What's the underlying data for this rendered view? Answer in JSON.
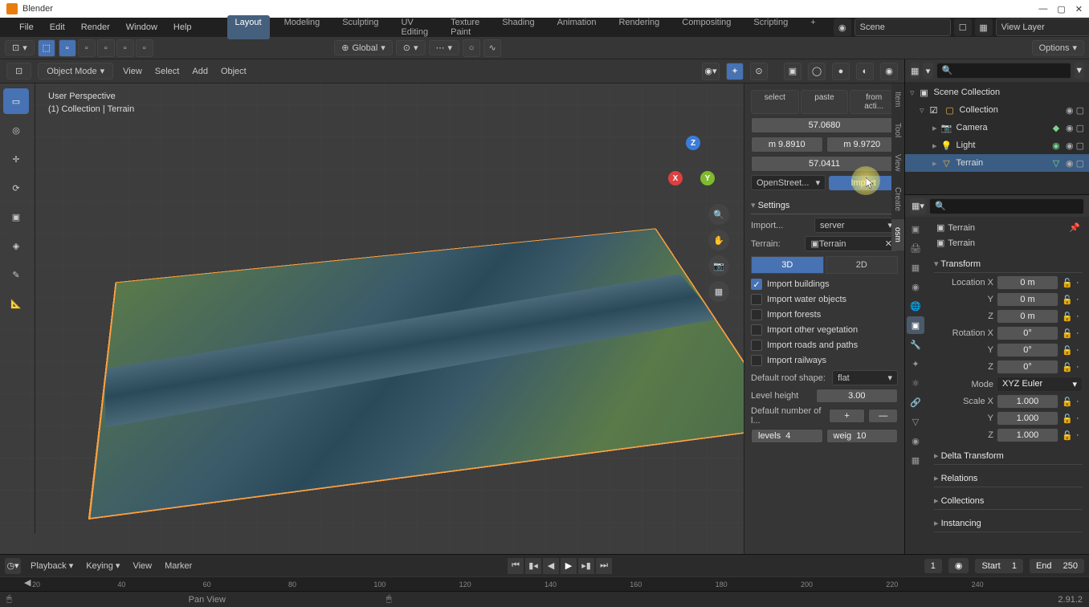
{
  "app": {
    "title": "Blender"
  },
  "menu": {
    "file": "File",
    "edit": "Edit",
    "render": "Render",
    "window": "Window",
    "help": "Help"
  },
  "workspaces": [
    "Layout",
    "Modeling",
    "Sculpting",
    "UV Editing",
    "Texture Paint",
    "Shading",
    "Animation",
    "Rendering",
    "Compositing",
    "Scripting"
  ],
  "scene_name": "Scene",
  "view_layer": "View Layer",
  "topbar2": {
    "orientation": "Global",
    "options": "Options"
  },
  "viewport": {
    "mode": "Object Mode",
    "menus": [
      "View",
      "Select",
      "Add",
      "Object"
    ],
    "info_line1": "User Perspective",
    "info_line2": "(1) Collection | Terrain"
  },
  "osm": {
    "buttons": [
      "select",
      "paste",
      "from acti..."
    ],
    "val1": "57.0680",
    "val2a": "m 9.8910",
    "val2b": "m 9.9720",
    "val3": "57.0411",
    "source": "OpenStreet...",
    "import_btn": "Import",
    "settings_title": "Settings",
    "import_from_lbl": "Import...",
    "import_from_val": "server",
    "terrain_lbl": "Terrain:",
    "terrain_val": "Terrain",
    "mode3d": "3D",
    "mode2d": "2D",
    "chk_buildings": "Import buildings",
    "chk_water": "Import water objects",
    "chk_forests": "Import forests",
    "chk_vegetation": "Import other vegetation",
    "chk_roads": "Import roads and paths",
    "chk_railways": "Import railways",
    "roof_lbl": "Default roof shape:",
    "roof_val": "flat",
    "level_height_lbl": "Level height",
    "level_height_val": "3.00",
    "def_levels_lbl": "Default number of l...",
    "def_levels_btn": "+",
    "levels_lbl": "levels",
    "levels_val": "4",
    "weig_lbl": "weig",
    "weig_val": "10"
  },
  "n_tabs": [
    "Item",
    "Tool",
    "View",
    "Create",
    "osm"
  ],
  "outliner": {
    "scene_coll": "Scene Collection",
    "collection": "Collection",
    "camera": "Camera",
    "light": "Light",
    "terrain": "Terrain"
  },
  "props": {
    "obj": "Terrain",
    "data": "Terrain",
    "transform": "Transform",
    "locx": "Location X",
    "locx_v": "0 m",
    "locy": "Y",
    "locy_v": "0 m",
    "locz": "Z",
    "locz_v": "0 m",
    "rotx": "Rotation X",
    "rotx_v": "0°",
    "roty": "Y",
    "roty_v": "0°",
    "rotz": "Z",
    "rotz_v": "0°",
    "mode_lbl": "Mode",
    "mode_v": "XYZ Euler",
    "sclx": "Scale X",
    "sclx_v": "1.000",
    "scly": "Y",
    "scly_v": "1.000",
    "sclz": "Z",
    "sclz_v": "1.000",
    "delta": "Delta Transform",
    "relations": "Relations",
    "collections": "Collections",
    "instancing": "Instancing"
  },
  "timeline": {
    "playback": "Playback",
    "keying": "Keying",
    "view": "View",
    "marker": "Marker",
    "cur": "1",
    "start": "Start",
    "start_v": "1",
    "end": "End",
    "end_v": "250"
  },
  "status": {
    "pan": "Pan View",
    "version": "2.91.2"
  }
}
